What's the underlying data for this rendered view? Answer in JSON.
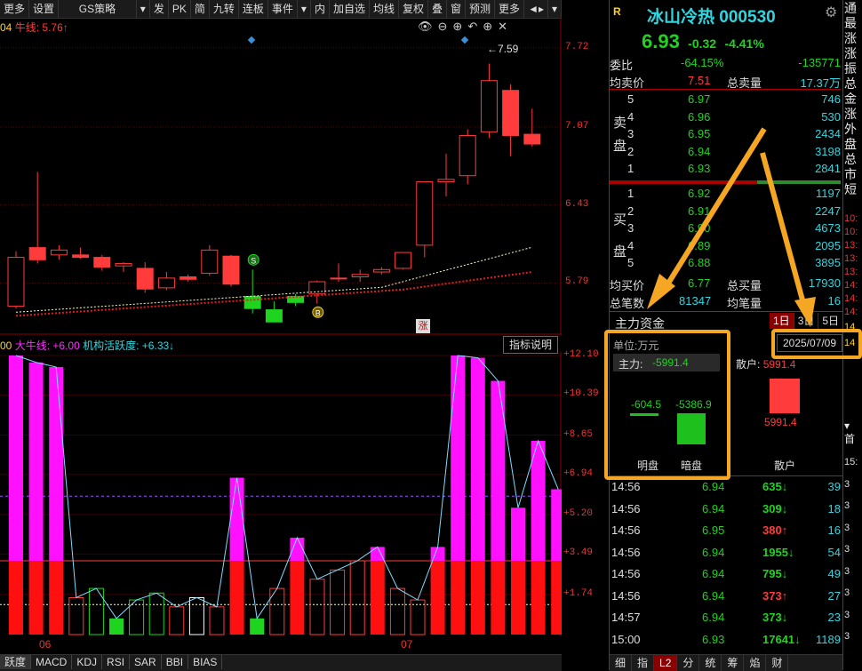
{
  "toolbar": {
    "items": [
      "更多",
      "设置",
      "GS策略",
      "▾",
      "发",
      "PK",
      "简",
      "九转",
      "连板",
      "事件",
      "▾",
      "内",
      "加自选",
      "均线",
      "复权",
      "叠",
      "窗",
      "预测",
      "更多",
      "◄▸",
      "▾"
    ]
  },
  "chart_top": {
    "legend_prefix": "04",
    "legend_name": "牛线:",
    "legend_value": "5.76",
    "legend_arrow": "↑",
    "y_ticks": [
      "7.72",
      "7.07",
      "6.43",
      "5.79"
    ],
    "high_label": "7.59",
    "marker_s": "S",
    "marker_b": "B",
    "marker_zhang": "涨"
  },
  "chart_data": [
    {
      "type": "candlestick",
      "title": "",
      "y_ticks": [
        7.72,
        7.07,
        6.43,
        5.79
      ],
      "ylim": [
        5.45,
        7.82
      ],
      "candles": [
        {
          "o": 5.6,
          "h": 6.05,
          "l": 5.58,
          "c": 6.0,
          "up": true
        },
        {
          "o": 6.08,
          "h": 6.7,
          "l": 5.95,
          "c": 5.98,
          "up": false
        },
        {
          "o": 6.02,
          "h": 6.1,
          "l": 5.98,
          "c": 6.06,
          "up": false
        },
        {
          "o": 6.02,
          "h": 6.08,
          "l": 5.99,
          "c": 6.0,
          "up": false
        },
        {
          "o": 6.0,
          "h": 6.02,
          "l": 5.89,
          "c": 5.92,
          "up": false
        },
        {
          "o": 5.93,
          "h": 5.96,
          "l": 5.88,
          "c": 5.95,
          "up": false
        },
        {
          "o": 5.91,
          "h": 5.96,
          "l": 5.71,
          "c": 5.74,
          "up": false
        },
        {
          "o": 5.75,
          "h": 5.88,
          "l": 5.73,
          "c": 5.83,
          "up": false
        },
        {
          "o": 5.84,
          "h": 5.86,
          "l": 5.8,
          "c": 5.82,
          "up": false
        },
        {
          "o": 5.87,
          "h": 6.1,
          "l": 5.85,
          "c": 6.06,
          "up": false
        },
        {
          "o": 6.01,
          "h": 6.02,
          "l": 5.76,
          "c": 5.78,
          "up": false
        },
        {
          "o": 5.68,
          "h": 5.9,
          "l": 5.54,
          "c": 5.58,
          "up": true
        },
        {
          "o": 5.57,
          "h": 5.64,
          "l": 5.47,
          "c": 5.47,
          "up": true
        },
        {
          "o": 5.63,
          "h": 5.7,
          "l": 5.6,
          "c": 5.68,
          "up": true
        },
        {
          "o": 5.7,
          "h": 5.81,
          "l": 5.62,
          "c": 5.8,
          "up": false
        },
        {
          "o": 5.83,
          "h": 5.95,
          "l": 5.8,
          "c": 5.83,
          "up": false
        },
        {
          "o": 5.84,
          "h": 5.9,
          "l": 5.8,
          "c": 5.86,
          "up": false
        },
        {
          "o": 5.88,
          "h": 5.92,
          "l": 5.86,
          "c": 5.9,
          "up": false
        },
        {
          "o": 5.91,
          "h": 6.04,
          "l": 5.9,
          "c": 6.04,
          "up": false
        },
        {
          "o": 6.1,
          "h": 6.62,
          "l": 6.0,
          "c": 6.62,
          "up": false
        },
        {
          "o": 6.62,
          "h": 6.85,
          "l": 6.5,
          "c": 6.64,
          "up": false
        },
        {
          "o": 6.67,
          "h": 7.05,
          "l": 6.6,
          "c": 7.0,
          "up": false
        },
        {
          "o": 7.03,
          "h": 7.59,
          "l": 6.98,
          "c": 7.45,
          "up": false
        },
        {
          "o": 7.37,
          "h": 7.42,
          "l": 6.83,
          "c": 7.0,
          "up": false
        },
        {
          "o": 7.01,
          "h": 7.22,
          "l": 6.91,
          "c": 6.93,
          "up": false
        }
      ],
      "highlight_green": [
        11,
        12,
        13
      ]
    },
    {
      "type": "bar",
      "title": "",
      "y_ticks": [
        12.1,
        10.39,
        8.65,
        6.94,
        5.2,
        3.49,
        1.74
      ],
      "ylim": [
        0,
        12.1
      ],
      "values": [
        12.1,
        11.8,
        11.6,
        1.6,
        2.0,
        0.7,
        1.5,
        1.8,
        1.2,
        1.6,
        1.2,
        6.8,
        0.7,
        2.0,
        4.2,
        2.4,
        2.8,
        3.2,
        3.8,
        2.0,
        1.5,
        3.8,
        12.1,
        12.0,
        11.0,
        5.5,
        8.4,
        6.3
      ],
      "red_base": 3.2
    }
  ],
  "chart_bottom": {
    "legend_prefix": "00",
    "legend_name": "大牛线:",
    "legend_value": "+6.00",
    "legend_name2": "机构活跃度:",
    "legend_value2": "+6.33",
    "legend_arrow2": "↓",
    "help_button": "指标说明",
    "y_ticks": [
      "+12.10",
      "+10.39",
      "+8.65",
      "+6.94",
      "+5.20",
      "+3.49",
      "+1.74"
    ],
    "x_labels": [
      "06",
      "07"
    ]
  },
  "bottom_tabs": [
    "跃度",
    "MACD",
    "KDJ",
    "RSI",
    "SAR",
    "BBI",
    "BIAS"
  ],
  "stock": {
    "name": "冰山冷热",
    "code": "000530",
    "price": "6.93",
    "change": "-0.32",
    "pct": "-4.41%",
    "r_marker": "R",
    "webi_label": "委比",
    "webi_value": "-64.15%",
    "webi_diff": "-135771",
    "avg_sell_label": "均卖价",
    "avg_sell_value": "7.51",
    "total_sell_label": "总卖量",
    "total_sell_value": "17.37万",
    "sell_label_1": "卖",
    "sell_label_2": "盘",
    "buy_label_1": "买",
    "buy_label_2": "盘",
    "asks": [
      {
        "lvl": "5",
        "price": "6.97",
        "vol": "746"
      },
      {
        "lvl": "4",
        "price": "6.96",
        "vol": "530"
      },
      {
        "lvl": "3",
        "price": "6.95",
        "vol": "2434"
      },
      {
        "lvl": "2",
        "price": "6.94",
        "vol": "3198"
      },
      {
        "lvl": "1",
        "price": "6.93",
        "vol": "2841"
      }
    ],
    "bids": [
      {
        "lvl": "1",
        "price": "6.92",
        "vol": "1197"
      },
      {
        "lvl": "2",
        "price": "6.91",
        "vol": "2247"
      },
      {
        "lvl": "3",
        "price": "6.90",
        "vol": "4673"
      },
      {
        "lvl": "4",
        "price": "6.89",
        "vol": "2095"
      },
      {
        "lvl": "5",
        "price": "6.88",
        "vol": "3895"
      }
    ],
    "avg_buy_label": "均买价",
    "avg_buy_value": "6.77",
    "total_buy_label": "总买量",
    "total_buy_value": "17930",
    "total_trades_label": "总笔数",
    "total_trades_value": "81347",
    "avg_trade_label": "均笔量",
    "avg_trade_value": "16"
  },
  "capital": {
    "title": "主力资金",
    "tabs": [
      "1日",
      "3日",
      "5日"
    ],
    "unit": "单位:万元",
    "date": "2025/07/09",
    "main_label": "主力:",
    "main_value": "-5991.4",
    "retail_label": "散户:",
    "retail_value": "5991.4",
    "ming_value": "-604.5",
    "an_value": "-5386.9",
    "retail_bar_value": "5991.4",
    "ming_label": "明盘",
    "an_label": "暗盘",
    "retail_bottom_label": "散户"
  },
  "ticks": [
    {
      "time": "14:56",
      "price": "6.94",
      "vol": "635",
      "dir": "down",
      "count": "39"
    },
    {
      "time": "14:56",
      "price": "6.94",
      "vol": "309",
      "dir": "down",
      "count": "18"
    },
    {
      "time": "14:56",
      "price": "6.95",
      "vol": "380",
      "dir": "up",
      "count": "16"
    },
    {
      "time": "14:56",
      "price": "6.94",
      "vol": "1955",
      "dir": "down",
      "count": "54"
    },
    {
      "time": "14:56",
      "price": "6.94",
      "vol": "795",
      "dir": "down",
      "count": "49"
    },
    {
      "time": "14:56",
      "price": "6.94",
      "vol": "373",
      "dir": "up",
      "count": "27"
    },
    {
      "time": "14:57",
      "price": "6.94",
      "vol": "373",
      "dir": "down",
      "count": "23"
    },
    {
      "time": "15:00",
      "price": "6.93",
      "vol": "17641",
      "dir": "down",
      "count": "1189"
    }
  ],
  "right_tabs": [
    "细",
    "指",
    "L2",
    "分",
    "统",
    "筹",
    "焰",
    "财"
  ],
  "side_chars": [
    "通",
    "最",
    "涨",
    "涨",
    "振",
    "总",
    "金",
    "涨",
    "外",
    "盘",
    "总",
    "市",
    "短"
  ],
  "side_times": [
    "10:",
    "10:",
    "13:",
    "13:",
    "13:",
    "14:",
    "14:",
    "14:"
  ],
  "side_times2": [
    "14",
    "14"
  ],
  "side_bottom_label": "首",
  "side_bottom_times": [
    "15:",
    "3",
    "3",
    "3",
    "3",
    "3",
    "3",
    "3",
    "3"
  ]
}
